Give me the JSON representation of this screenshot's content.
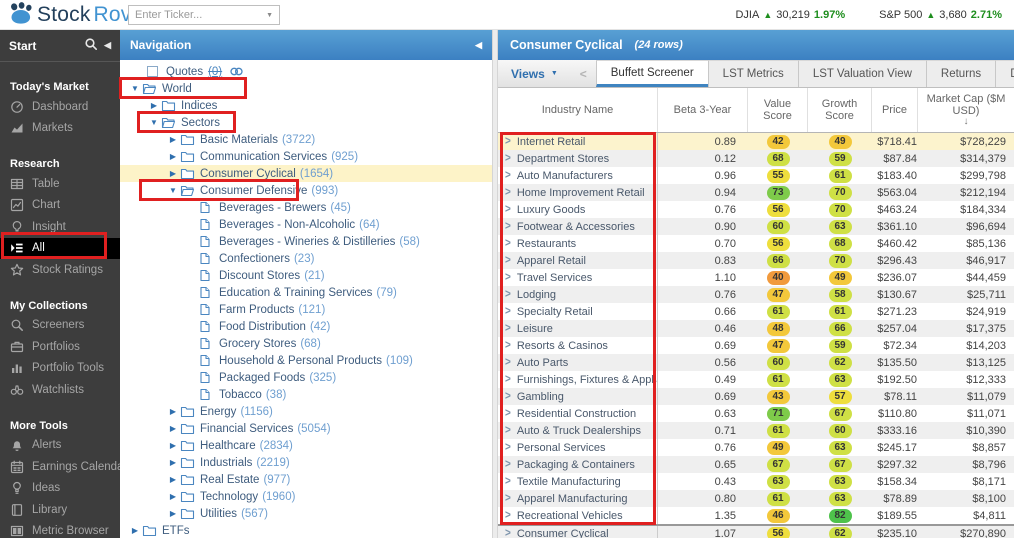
{
  "top_bar": {
    "logo": {
      "stock": "Stock",
      "rover": "Rover"
    },
    "ticker_input_placeholder": "Enter Ticker...",
    "indices": [
      {
        "name": "DJIA",
        "arrow": "▲",
        "value": "30,219",
        "change": "1.97%"
      },
      {
        "name": "S&P 500",
        "arrow": "▲",
        "value": "3,680",
        "change": "2.71%"
      }
    ]
  },
  "sidebar": {
    "header": "Start",
    "sections": [
      {
        "title": "Today's Market",
        "items": [
          {
            "label": "Dashboard",
            "icon": "dashboard-icon"
          },
          {
            "label": "Markets",
            "icon": "markets-icon"
          }
        ]
      },
      {
        "title": "Research",
        "items": [
          {
            "label": "Table",
            "icon": "table-icon"
          },
          {
            "label": "Chart",
            "icon": "chart-icon"
          },
          {
            "label": "Insight",
            "icon": "insight-icon"
          },
          {
            "label": "All",
            "icon": "all-icon",
            "active": true
          },
          {
            "label": "Stock Ratings",
            "icon": "star-icon"
          }
        ]
      },
      {
        "title": "My Collections",
        "items": [
          {
            "label": "Screeners",
            "icon": "search-icon"
          },
          {
            "label": "Portfolios",
            "icon": "briefcase-icon"
          },
          {
            "label": "Portfolio Tools",
            "icon": "bar-chart-icon"
          },
          {
            "label": "Watchlists",
            "icon": "binoculars-icon"
          }
        ]
      },
      {
        "title": "More Tools",
        "items": [
          {
            "label": "Alerts",
            "icon": "bell-icon"
          },
          {
            "label": "Earnings Calendar",
            "icon": "calendar-icon"
          },
          {
            "label": "Ideas",
            "icon": "lightbulb-icon"
          },
          {
            "label": "Library",
            "icon": "book-icon"
          },
          {
            "label": "Metric Browser",
            "icon": "columns-icon"
          }
        ]
      }
    ]
  },
  "navigation": {
    "title": "Navigation",
    "tree": [
      {
        "level": 1,
        "kind": "quotes",
        "label": "Quotes",
        "count": "(0)"
      },
      {
        "level": 0,
        "kind": "folder",
        "state": "open",
        "label": "World"
      },
      {
        "level": 1,
        "kind": "folder",
        "state": "closed",
        "label": "Indices"
      },
      {
        "level": 1,
        "kind": "folder",
        "state": "open",
        "label": "Sectors"
      },
      {
        "level": 2,
        "kind": "folder",
        "state": "closed",
        "label": "Basic Materials",
        "count": "(3722)"
      },
      {
        "level": 2,
        "kind": "folder",
        "state": "closed",
        "label": "Communication Services",
        "count": "(925)"
      },
      {
        "level": 2,
        "kind": "folder",
        "state": "closed",
        "label": "Consumer Cyclical",
        "count": "(1654)",
        "selected": true
      },
      {
        "level": 2,
        "kind": "folder",
        "state": "open",
        "label": "Consumer Defensive",
        "count": "(993)"
      },
      {
        "level": 3,
        "kind": "leaf",
        "label": "Beverages - Brewers",
        "count": "(45)"
      },
      {
        "level": 3,
        "kind": "leaf",
        "label": "Beverages - Non-Alcoholic",
        "count": "(64)"
      },
      {
        "level": 3,
        "kind": "leaf",
        "label": "Beverages - Wineries & Distilleries",
        "count": "(58)"
      },
      {
        "level": 3,
        "kind": "leaf",
        "label": "Confectioners",
        "count": "(23)"
      },
      {
        "level": 3,
        "kind": "leaf",
        "label": "Discount Stores",
        "count": "(21)"
      },
      {
        "level": 3,
        "kind": "leaf",
        "label": "Education & Training Services",
        "count": "(79)"
      },
      {
        "level": 3,
        "kind": "leaf",
        "label": "Farm Products",
        "count": "(121)"
      },
      {
        "level": 3,
        "kind": "leaf",
        "label": "Food Distribution",
        "count": "(42)"
      },
      {
        "level": 3,
        "kind": "leaf",
        "label": "Grocery Stores",
        "count": "(68)"
      },
      {
        "level": 3,
        "kind": "leaf",
        "label": "Household & Personal Products",
        "count": "(109)"
      },
      {
        "level": 3,
        "kind": "leaf",
        "label": "Packaged Foods",
        "count": "(325)"
      },
      {
        "level": 3,
        "kind": "leaf",
        "label": "Tobacco",
        "count": "(38)"
      },
      {
        "level": 2,
        "kind": "folder",
        "state": "closed",
        "label": "Energy",
        "count": "(1156)"
      },
      {
        "level": 2,
        "kind": "folder",
        "state": "closed",
        "label": "Financial Services",
        "count": "(5054)"
      },
      {
        "level": 2,
        "kind": "folder",
        "state": "closed",
        "label": "Healthcare",
        "count": "(2834)"
      },
      {
        "level": 2,
        "kind": "folder",
        "state": "closed",
        "label": "Industrials",
        "count": "(2219)"
      },
      {
        "level": 2,
        "kind": "folder",
        "state": "closed",
        "label": "Real Estate",
        "count": "(977)"
      },
      {
        "level": 2,
        "kind": "folder",
        "state": "closed",
        "label": "Technology",
        "count": "(1960)"
      },
      {
        "level": 2,
        "kind": "folder",
        "state": "closed",
        "label": "Utilities",
        "count": "(567)"
      },
      {
        "level": 0,
        "kind": "folder",
        "state": "closed",
        "label": "ETFs"
      }
    ]
  },
  "main": {
    "title": "Consumer Cyclical",
    "subtitle": "(24 rows)",
    "views_label": "Views",
    "tabs": [
      {
        "label": "Buffett Screener",
        "active": true
      },
      {
        "label": "LST Metrics"
      },
      {
        "label": "LST Valuation View"
      },
      {
        "label": "Returns"
      },
      {
        "label": "Dividend Calendar"
      }
    ],
    "table": {
      "columns": [
        "Industry Name",
        "Beta 3-Year",
        "Value Score",
        "Growth Score",
        "Price",
        "Market Cap ($M USD)"
      ],
      "sort": {
        "column_index": 5,
        "direction": "desc"
      },
      "rows": [
        {
          "name": "Internet Retail",
          "beta": "0.89",
          "value_score": 42,
          "growth_score": 49,
          "price": "$718.41",
          "market_cap": "$728,229",
          "selected": true
        },
        {
          "name": "Department Stores",
          "beta": "0.12",
          "value_score": 68,
          "growth_score": 59,
          "price": "$87.84",
          "market_cap": "$314,379"
        },
        {
          "name": "Auto Manufacturers",
          "beta": "0.96",
          "value_score": 55,
          "growth_score": 61,
          "price": "$183.40",
          "market_cap": "$299,798"
        },
        {
          "name": "Home Improvement Retail",
          "beta": "0.94",
          "value_score": 73,
          "growth_score": 70,
          "price": "$563.04",
          "market_cap": "$212,194"
        },
        {
          "name": "Luxury Goods",
          "beta": "0.76",
          "value_score": 56,
          "growth_score": 70,
          "price": "$463.24",
          "market_cap": "$184,334"
        },
        {
          "name": "Footwear & Accessories",
          "beta": "0.90",
          "value_score": 60,
          "growth_score": 63,
          "price": "$361.10",
          "market_cap": "$96,694"
        },
        {
          "name": "Restaurants",
          "beta": "0.70",
          "value_score": 56,
          "growth_score": 68,
          "price": "$460.42",
          "market_cap": "$85,136"
        },
        {
          "name": "Apparel Retail",
          "beta": "0.83",
          "value_score": 66,
          "growth_score": 70,
          "price": "$296.43",
          "market_cap": "$46,917"
        },
        {
          "name": "Travel Services",
          "beta": "1.10",
          "value_score": 40,
          "growth_score": 49,
          "price": "$236.07",
          "market_cap": "$44,459"
        },
        {
          "name": "Lodging",
          "beta": "0.76",
          "value_score": 47,
          "growth_score": 58,
          "price": "$130.67",
          "market_cap": "$25,711"
        },
        {
          "name": "Specialty Retail",
          "beta": "0.66",
          "value_score": 61,
          "growth_score": 61,
          "price": "$271.23",
          "market_cap": "$24,919"
        },
        {
          "name": "Leisure",
          "beta": "0.46",
          "value_score": 48,
          "growth_score": 66,
          "price": "$257.04",
          "market_cap": "$17,375"
        },
        {
          "name": "Resorts & Casinos",
          "beta": "0.69",
          "value_score": 47,
          "growth_score": 59,
          "price": "$72.34",
          "market_cap": "$14,203"
        },
        {
          "name": "Auto Parts",
          "beta": "0.56",
          "value_score": 60,
          "growth_score": 62,
          "price": "$135.50",
          "market_cap": "$13,125"
        },
        {
          "name": "Furnishings, Fixtures & Applian...",
          "beta": "0.49",
          "value_score": 61,
          "growth_score": 63,
          "price": "$192.50",
          "market_cap": "$12,333"
        },
        {
          "name": "Gambling",
          "beta": "0.69",
          "value_score": 43,
          "growth_score": 57,
          "price": "$78.11",
          "market_cap": "$11,079"
        },
        {
          "name": "Residential Construction",
          "beta": "0.63",
          "value_score": 71,
          "growth_score": 67,
          "price": "$110.80",
          "market_cap": "$11,071"
        },
        {
          "name": "Auto & Truck Dealerships",
          "beta": "0.71",
          "value_score": 61,
          "growth_score": 60,
          "price": "$333.16",
          "market_cap": "$10,390"
        },
        {
          "name": "Personal Services",
          "beta": "0.76",
          "value_score": 49,
          "growth_score": 63,
          "price": "$245.17",
          "market_cap": "$8,857"
        },
        {
          "name": "Packaging & Containers",
          "beta": "0.65",
          "value_score": 67,
          "growth_score": 67,
          "price": "$297.32",
          "market_cap": "$8,796"
        },
        {
          "name": "Textile Manufacturing",
          "beta": "0.43",
          "value_score": 63,
          "growth_score": 63,
          "price": "$158.34",
          "market_cap": "$8,171"
        },
        {
          "name": "Apparel Manufacturing",
          "beta": "0.80",
          "value_score": 61,
          "growth_score": 63,
          "price": "$78.89",
          "market_cap": "$8,100"
        },
        {
          "name": "Recreational Vehicles",
          "beta": "1.35",
          "value_score": 46,
          "growth_score": 82,
          "price": "$189.55",
          "market_cap": "$4,811"
        },
        {
          "name": "Consumer Cyclical",
          "beta": "1.07",
          "value_score": 56,
          "growth_score": 62,
          "price": "$235.10",
          "market_cap": "$270,890",
          "summary": true
        }
      ]
    }
  },
  "score_color_scale": [
    {
      "max": 41,
      "color": "#f19a3d"
    },
    {
      "max": 49,
      "color": "#f3c83b"
    },
    {
      "max": 57,
      "color": "#eede3d"
    },
    {
      "max": 70,
      "color": "#cfe045"
    },
    {
      "max": 79,
      "color": "#7ecb4a"
    },
    {
      "max": 100,
      "color": "#4ec24b"
    }
  ],
  "colors": {
    "accent_blue": "#3f84c0",
    "positive_green": "#1e8e1e",
    "annotation_red": "#e02020",
    "selected_row_yellow": "#fcf3cd"
  }
}
